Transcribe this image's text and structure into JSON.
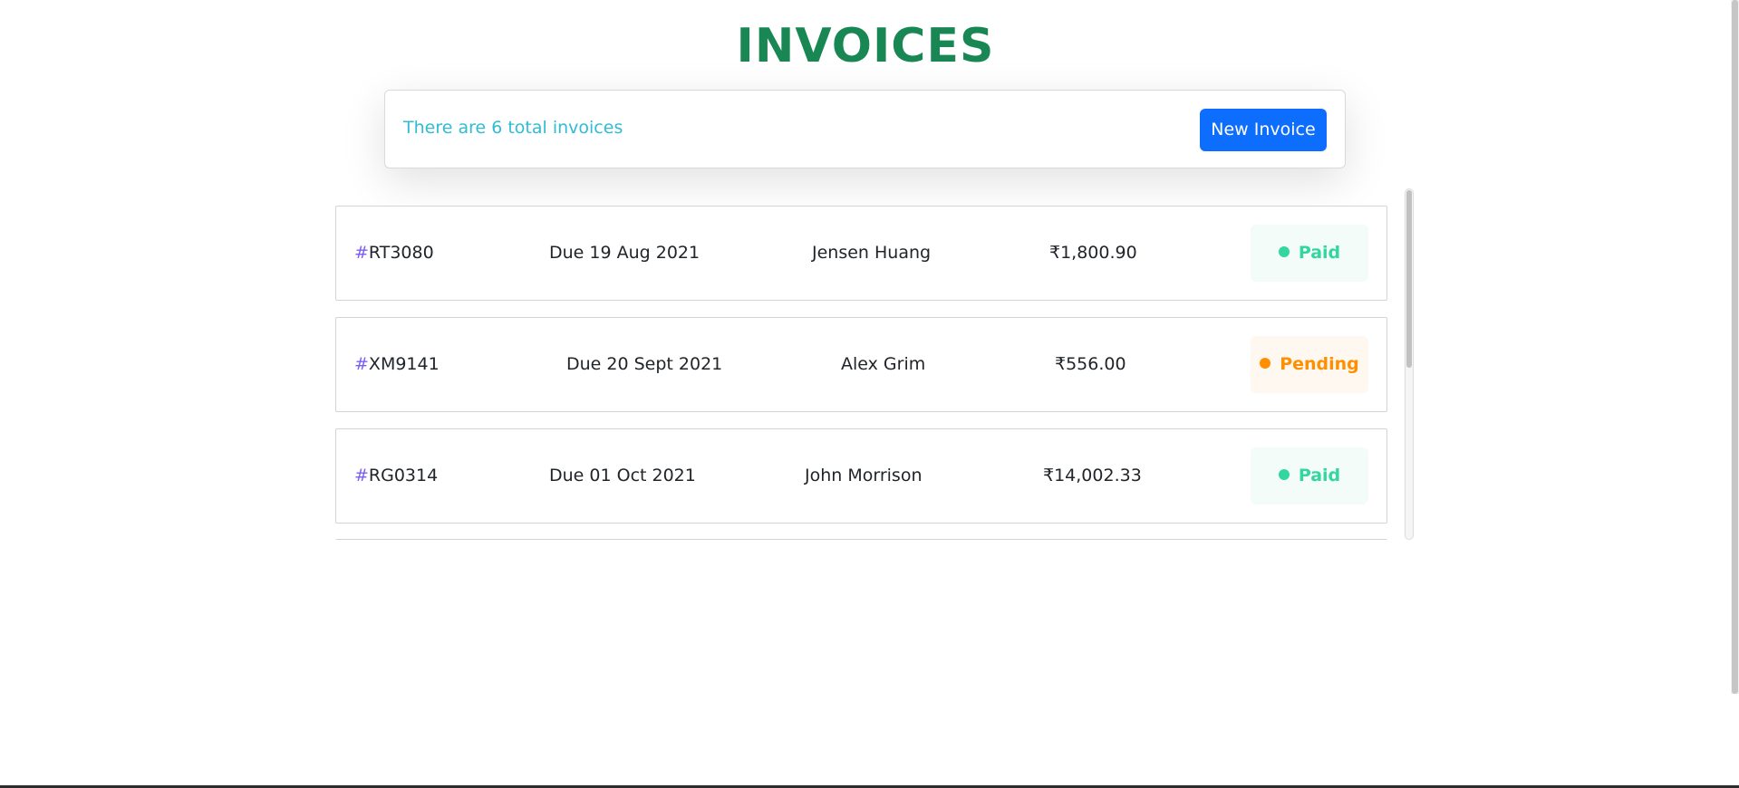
{
  "header": {
    "title": "INVOICES"
  },
  "summary": {
    "text": "There are 6 total invoices",
    "new_invoice_label": "New Invoice"
  },
  "invoices": [
    {
      "hash": "#",
      "id": "RT3080",
      "due": "Due 19 Aug 2021",
      "client": "Jensen Huang",
      "amount": "₹1,800.90",
      "status": "Paid"
    },
    {
      "hash": "#",
      "id": "XM9141",
      "due": "Due 20 Sept 2021",
      "client": "Alex Grim",
      "amount": "₹556.00",
      "status": "Pending"
    },
    {
      "hash": "#",
      "id": "RG0314",
      "due": "Due 01 Oct 2021",
      "client": "John Morrison",
      "amount": "₹14,002.33",
      "status": "Paid"
    }
  ],
  "colors": {
    "title": "#198754",
    "summary_text": "#2fbcd4",
    "button": "#0d6efd",
    "paid": "#33d69f",
    "pending": "#ff8f00"
  }
}
